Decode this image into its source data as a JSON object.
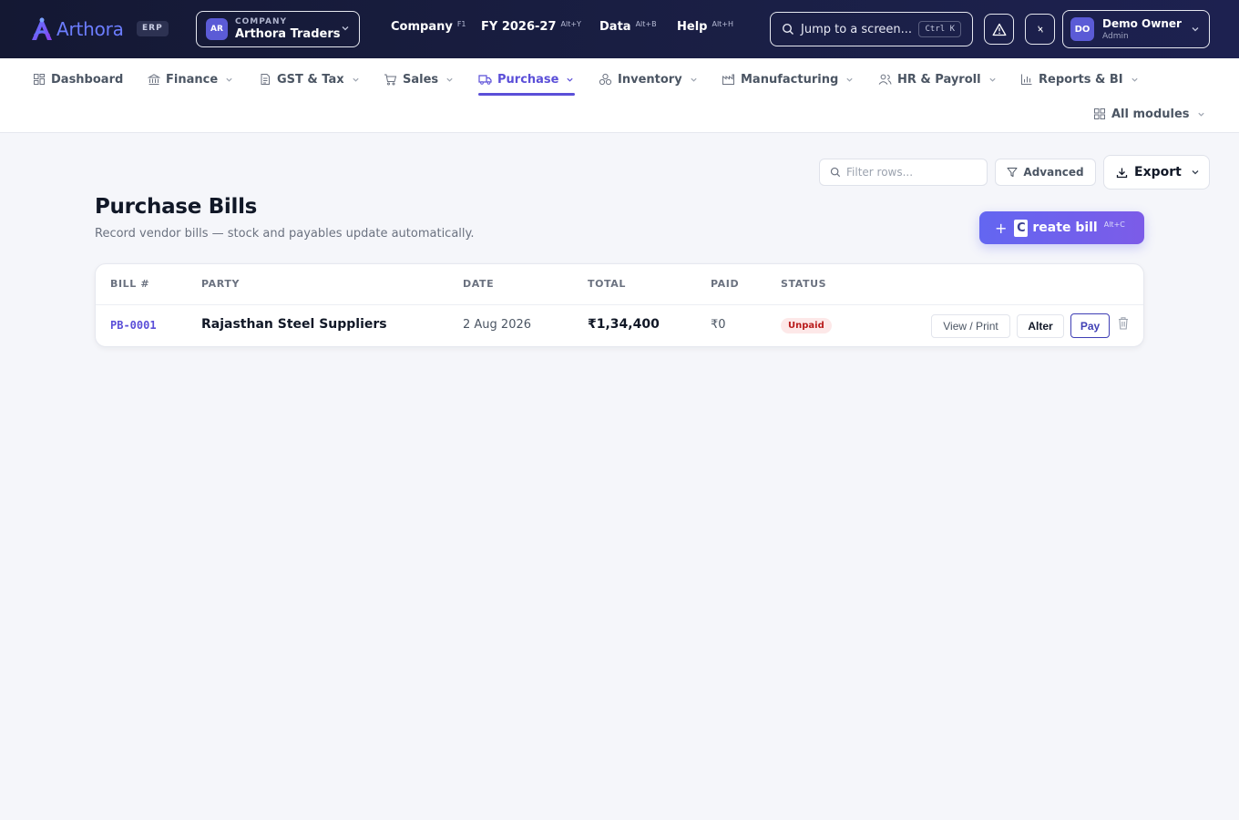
{
  "brand": {
    "name": "Arthora",
    "badge": "ERP"
  },
  "company": {
    "initials": "AR",
    "caption": "COMPANY",
    "name": "Arthora Traders"
  },
  "top_menu": [
    {
      "label": "Company",
      "shortcut": "F1"
    },
    {
      "label": "FY 2026-27",
      "shortcut": "Alt+Y"
    },
    {
      "label": "Data",
      "shortcut": "Alt+B"
    },
    {
      "label": "Help",
      "shortcut": "Alt+H"
    }
  ],
  "search": {
    "placeholder": "Jump to a screen...",
    "shortcut": "Ctrl K"
  },
  "user": {
    "initials": "DO",
    "name": "Demo Owner",
    "role": "Admin"
  },
  "modules": [
    {
      "label": "Dashboard",
      "icon": "grid-icon"
    },
    {
      "label": "Finance",
      "icon": "bank-icon"
    },
    {
      "label": "GST & Tax",
      "icon": "document-icon"
    },
    {
      "label": "Sales",
      "icon": "cart-icon"
    },
    {
      "label": "Purchase",
      "icon": "truck-icon",
      "active": true
    },
    {
      "label": "Inventory",
      "icon": "boxes-icon"
    },
    {
      "label": "Manufacturing",
      "icon": "factory-icon"
    },
    {
      "label": "HR & Payroll",
      "icon": "users-icon"
    },
    {
      "label": "Reports & BI",
      "icon": "bar-chart-icon"
    }
  ],
  "all_modules": "All modules",
  "toolbar": {
    "filter_placeholder": "Filter rows...",
    "advanced": "Advanced",
    "export": "Export"
  },
  "page": {
    "title": "Purchase Bills",
    "subtitle": "Record vendor bills — stock and payables update automatically."
  },
  "create": {
    "plus": "+",
    "key_letter": "C",
    "label": "reate bill",
    "shortcut": "Alt+C"
  },
  "table": {
    "columns": [
      "BILL #",
      "PARTY",
      "DATE",
      "TOTAL",
      "PAID",
      "STATUS"
    ],
    "rows": [
      {
        "bill": "PB-0001",
        "party": "Rajasthan Steel Suppliers",
        "date": "2 Aug 2026",
        "total": "₹1,34,400",
        "paid": "₹0",
        "status": "Unpaid",
        "status_color": "#b91c1c"
      }
    ],
    "actions": {
      "view": "View / Print",
      "alter": "Alter",
      "pay": "Pay"
    }
  },
  "colors": {
    "accent": "#5b4fd8",
    "topbar": "#141833",
    "danger": "#b91c1c"
  }
}
